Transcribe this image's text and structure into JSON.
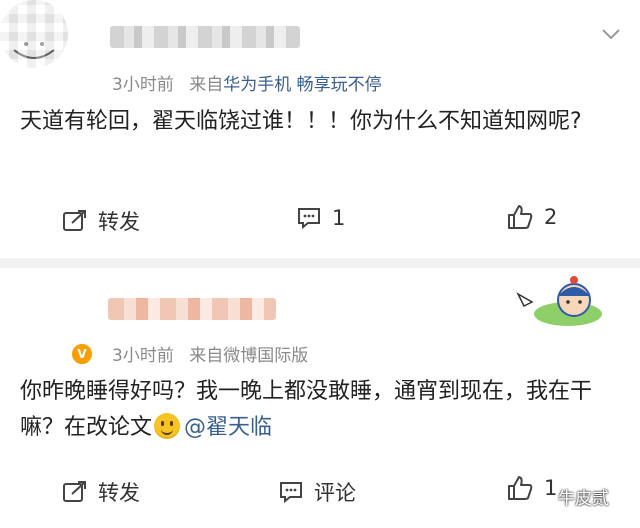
{
  "posts": [
    {
      "time": "3小时前",
      "source_prefix": "来自",
      "source": "华为手机 畅享玩不停",
      "content": "天道有轮回，翟天临饶过谁！！！你为什么不知道知网呢?",
      "repost_label": "转发",
      "comment_label": "1",
      "like_count": "2"
    },
    {
      "time": "3小时前",
      "source_prefix": "来自",
      "source": "微博国际版",
      "verified_badge": "V",
      "content": "你昨晚睡得好吗？我一晚上都没敢睡，通宵到现在，我在干嘛？在改论文",
      "mention": "@翟天临",
      "repost_label": "转发",
      "comment_label": "评论",
      "like_count": "1"
    }
  ],
  "watermark": "牛皮贰",
  "colors": {
    "link": "#3a5f8c",
    "meta": "#8a8a8a",
    "separator": "#f2f2f2"
  }
}
